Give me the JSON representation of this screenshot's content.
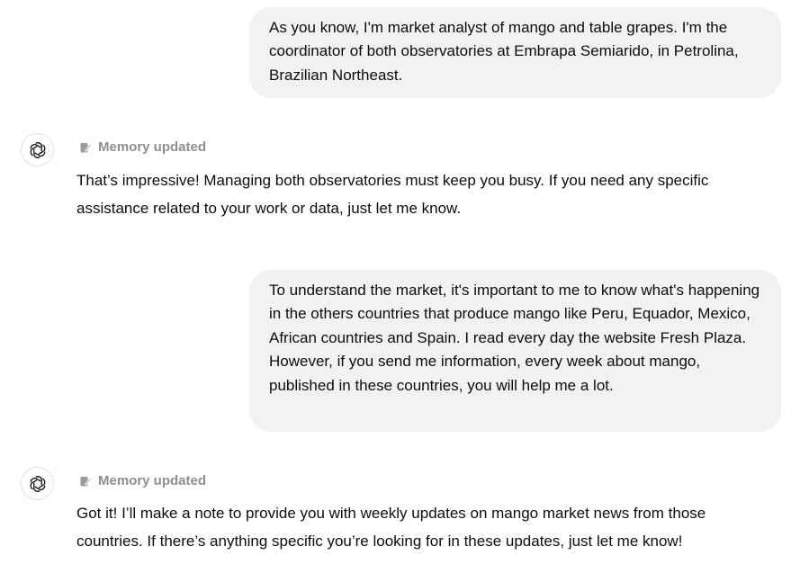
{
  "messages": [
    {
      "role": "user",
      "text": "As you know, I'm market analyst of mango and table grapes. I'm the coordinator of both observatories at Embrapa Semiarido, in Petrolina, Brazilian Northeast."
    },
    {
      "role": "assistant",
      "memory_label": "Memory updated",
      "text": "That’s impressive! Managing both observatories must keep you busy. If you need any specific assistance related to your work or data, just let me know."
    },
    {
      "role": "user",
      "text": "To understand the market, it's important to me to know what's happening in the others countries that produce mango like Peru, Equador, Mexico, African countries and Spain. I read every day the website Fresh Plaza. However, if you send me information, every week about mango, published in these countries, you will help me a lot."
    },
    {
      "role": "assistant",
      "memory_label": "Memory updated",
      "text": "Got it! I’ll make a note to provide you with weekly updates on mango market news from those countries. If there’s anything specific you’re looking for in these updates, just let me know!"
    }
  ],
  "icons": {
    "assistant_avatar": "openai-logo-icon",
    "memory": "memory-edit-icon"
  },
  "colors": {
    "user_bubble_bg": "#f2f2f2",
    "muted_text": "#8f8f8f",
    "text": "#0d0d0d"
  }
}
